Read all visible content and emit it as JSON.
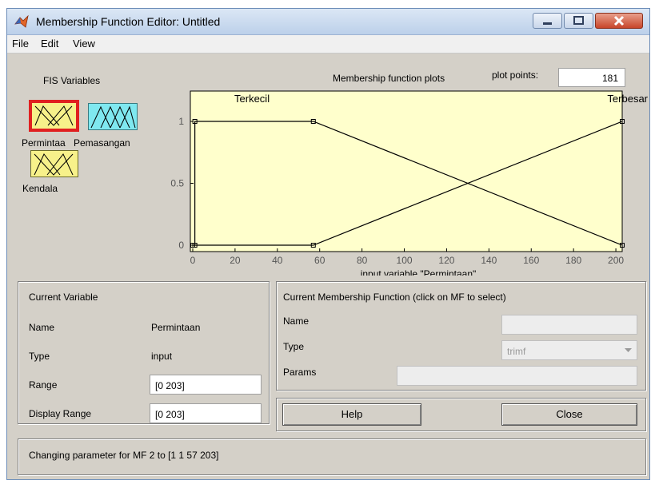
{
  "window": {
    "title": "Membership Function Editor: Untitled"
  },
  "menu": [
    "File",
    "Edit",
    "View"
  ],
  "fis_variables": {
    "heading": "FIS Variables",
    "items": [
      {
        "name": "Permintaan",
        "label": "Permintaa",
        "color": "#f7f18a",
        "selected": true
      },
      {
        "name": "Pemasangan",
        "label": "Pemasangan",
        "color": "#7fe8f0",
        "selected": false
      },
      {
        "name": "Kendala",
        "label": "Kendala",
        "color": "#f7f18a",
        "selected": false
      }
    ]
  },
  "plot": {
    "title": "Membership function plots",
    "plot_points_label": "plot points:",
    "plot_points_value": "181"
  },
  "chart_data": {
    "type": "line",
    "xlabel": "input variable \"Permintaan\"",
    "xlim": [
      0,
      203
    ],
    "ylim": [
      0,
      1
    ],
    "xticks": [
      0,
      20,
      40,
      60,
      80,
      100,
      120,
      140,
      160,
      180,
      200
    ],
    "yticks": [
      0,
      0.5,
      1
    ],
    "ytick_labels": [
      "0",
      "0.5",
      "1"
    ],
    "background": "#ffffcc",
    "series": [
      {
        "name": "Terkecil",
        "x": [
          1,
          1,
          57,
          203
        ],
        "y": [
          0,
          1,
          1,
          0
        ],
        "color": "#000000"
      },
      {
        "name": "Terbesar",
        "x": [
          0,
          57,
          203,
          203
        ],
        "y": [
          0,
          0,
          1,
          1
        ],
        "color": "#000000"
      }
    ]
  },
  "current_variable": {
    "heading": "Current Variable",
    "name_label": "Name",
    "name_value": "Permintaan",
    "type_label": "Type",
    "type_value": "input",
    "range_label": "Range",
    "range_value": "[0 203]",
    "display_range_label": "Display Range",
    "display_range_value": "[0 203]"
  },
  "current_mf": {
    "heading": "Current Membership Function (click on MF to select)",
    "name_label": "Name",
    "name_value": "",
    "type_label": "Type",
    "type_value": "trimf",
    "params_label": "Params",
    "params_value": ""
  },
  "buttons": {
    "help": "Help",
    "close": "Close"
  },
  "status": "Changing parameter for MF 2 to  [1 1 57 203]"
}
